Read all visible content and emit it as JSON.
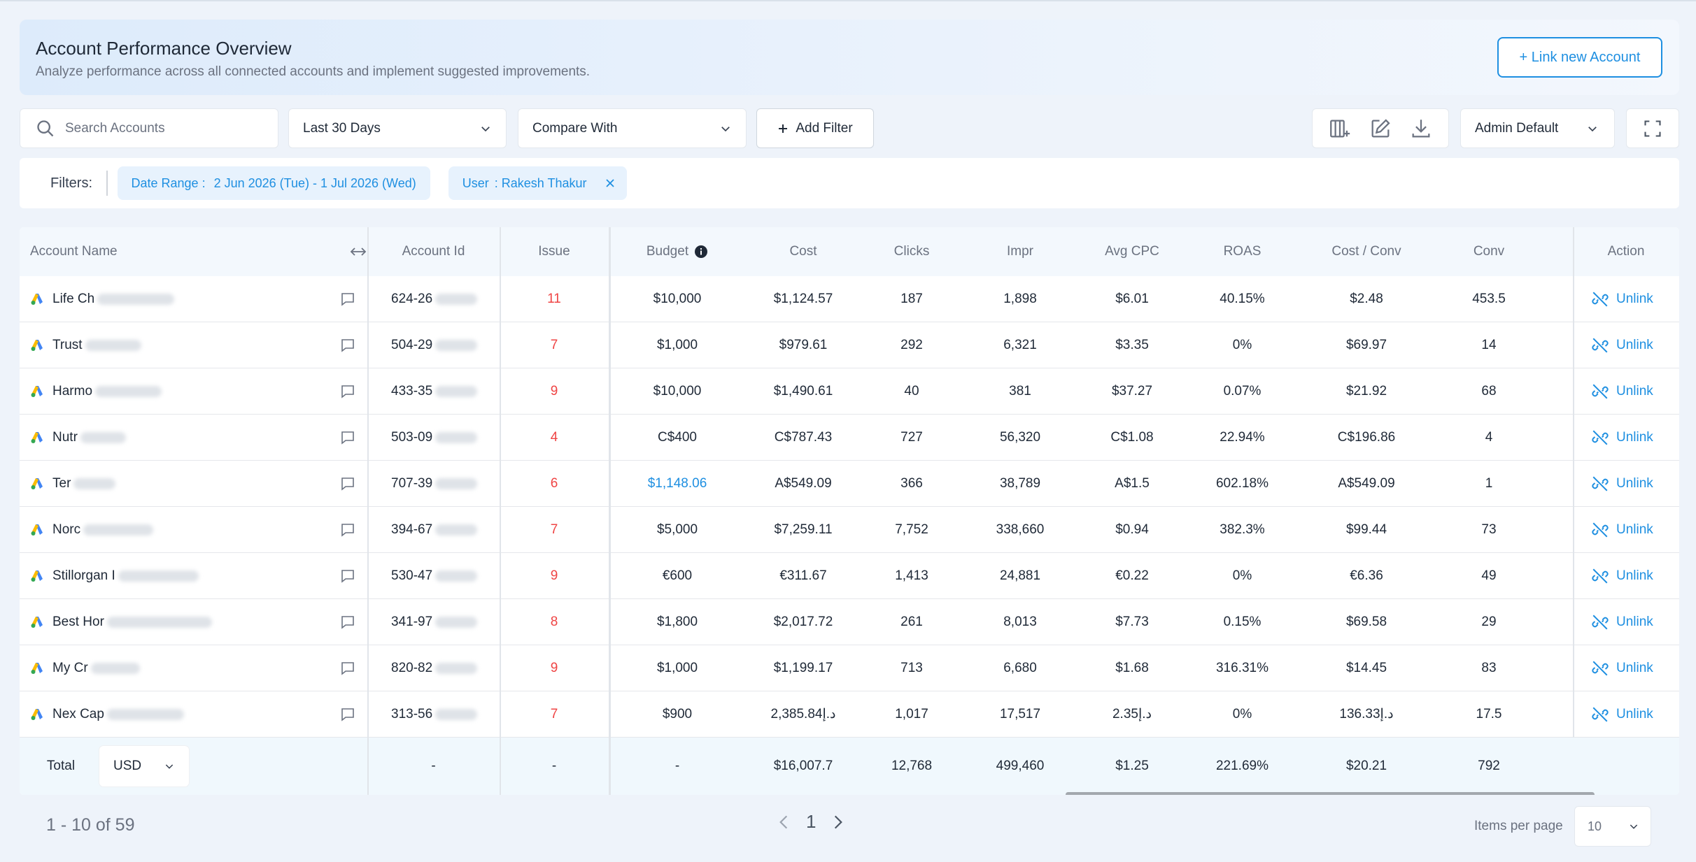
{
  "header": {
    "title": "Account Performance Overview",
    "subtitle": "Analyze performance across all connected accounts and implement suggested improvements.",
    "link_button": "+ Link new Account"
  },
  "toolbar": {
    "search_placeholder": "Search Accounts",
    "date_range": "Last 30 Days",
    "compare": "Compare With",
    "add_filter": "Add Filter",
    "view": "Admin Default"
  },
  "filters": {
    "label": "Filters:",
    "date_range_label": "Date Range :",
    "date_range_value": "2 Jun 2026 (Tue) - 1 Jul 2026 (Wed)",
    "user_label": "User",
    "user_value": ": Rakesh Thakur"
  },
  "columns": [
    "Account Name",
    "Account Id",
    "Issue",
    "Budget",
    "Cost",
    "Clicks",
    "Impr",
    "Avg CPC",
    "ROAS",
    "Cost / Conv",
    "Conv",
    "Action"
  ],
  "rows": [
    {
      "name": "Life Ch",
      "id": "624-26",
      "issue": "11",
      "budget": "$10,000",
      "cost": "$1,124.57",
      "clicks": "187",
      "impr": "1,898",
      "cpc": "$6.01",
      "roas": "40.15%",
      "cpconv": "$2.48",
      "conv": "453.5",
      "action": "Unlink"
    },
    {
      "name": "Trust",
      "id": "504-29",
      "issue": "7",
      "budget": "$1,000",
      "cost": "$979.61",
      "clicks": "292",
      "impr": "6,321",
      "cpc": "$3.35",
      "roas": "0%",
      "cpconv": "$69.97",
      "conv": "14",
      "action": "Unlink"
    },
    {
      "name": "Harmo",
      "id": "433-35",
      "issue": "9",
      "budget": "$10,000",
      "cost": "$1,490.61",
      "clicks": "40",
      "impr": "381",
      "cpc": "$37.27",
      "roas": "0.07%",
      "cpconv": "$21.92",
      "conv": "68",
      "action": "Unlink"
    },
    {
      "name": "Nutr",
      "id": "503-09",
      "issue": "4",
      "budget": "C$400",
      "cost": "C$787.43",
      "clicks": "727",
      "impr": "56,320",
      "cpc": "C$1.08",
      "roas": "22.94%",
      "cpconv": "C$196.86",
      "conv": "4",
      "action": "Unlink"
    },
    {
      "name": "Ter",
      "id": "707-39",
      "issue": "6",
      "budget": "$1,148.06",
      "cost": "A$549.09",
      "clicks": "366",
      "impr": "38,789",
      "cpc": "A$1.5",
      "roas": "602.18%",
      "cpconv": "A$549.09",
      "conv": "1",
      "action": "Unlink",
      "budget_link": true
    },
    {
      "name": "Norc",
      "id": "394-67",
      "issue": "7",
      "budget": "$5,000",
      "cost": "$7,259.11",
      "clicks": "7,752",
      "impr": "338,660",
      "cpc": "$0.94",
      "roas": "382.3%",
      "cpconv": "$99.44",
      "conv": "73",
      "action": "Unlink"
    },
    {
      "name": "Stillorgan I",
      "id": "530-47",
      "issue": "9",
      "budget": "€600",
      "cost": "€311.67",
      "clicks": "1,413",
      "impr": "24,881",
      "cpc": "€0.22",
      "roas": "0%",
      "cpconv": "€6.36",
      "conv": "49",
      "action": "Unlink"
    },
    {
      "name": "Best Hor",
      "id": "341-97",
      "issue": "8",
      "budget": "$1,800",
      "cost": "$2,017.72",
      "clicks": "261",
      "impr": "8,013",
      "cpc": "$7.73",
      "roas": "0.15%",
      "cpconv": "$69.58",
      "conv": "29",
      "action": "Unlink"
    },
    {
      "name": "My Cr",
      "id": "820-82",
      "issue": "9",
      "budget": "$1,000",
      "cost": "$1,199.17",
      "clicks": "713",
      "impr": "6,680",
      "cpc": "$1.68",
      "roas": "316.31%",
      "cpconv": "$14.45",
      "conv": "83",
      "action": "Unlink"
    },
    {
      "name": "Nex Cap",
      "id": "313-56",
      "issue": "7",
      "budget": "$900",
      "cost": "2,385.84د.إ",
      "clicks": "1,017",
      "impr": "17,517",
      "cpc": "2.35د.إ",
      "roas": "0%",
      "cpconv": "136.33د.إ",
      "conv": "17.5",
      "action": "Unlink"
    }
  ],
  "total": {
    "label": "Total",
    "currency": "USD",
    "id": "-",
    "issue": "-",
    "budget": "-",
    "cost": "$16,007.7",
    "clicks": "12,768",
    "impr": "499,460",
    "cpc": "$1.25",
    "roas": "221.69%",
    "cpconv": "$20.21",
    "conv": "792"
  },
  "footer": {
    "range": "1 - 10 of 59",
    "page": "1",
    "items_per_page_label": "Items per page",
    "items_per_page": "10"
  },
  "colors": {
    "accent": "#1e8fe1",
    "issue": "#ef4444",
    "header_bg": "#f3f8fd",
    "total_bg": "#f0f8fd"
  }
}
